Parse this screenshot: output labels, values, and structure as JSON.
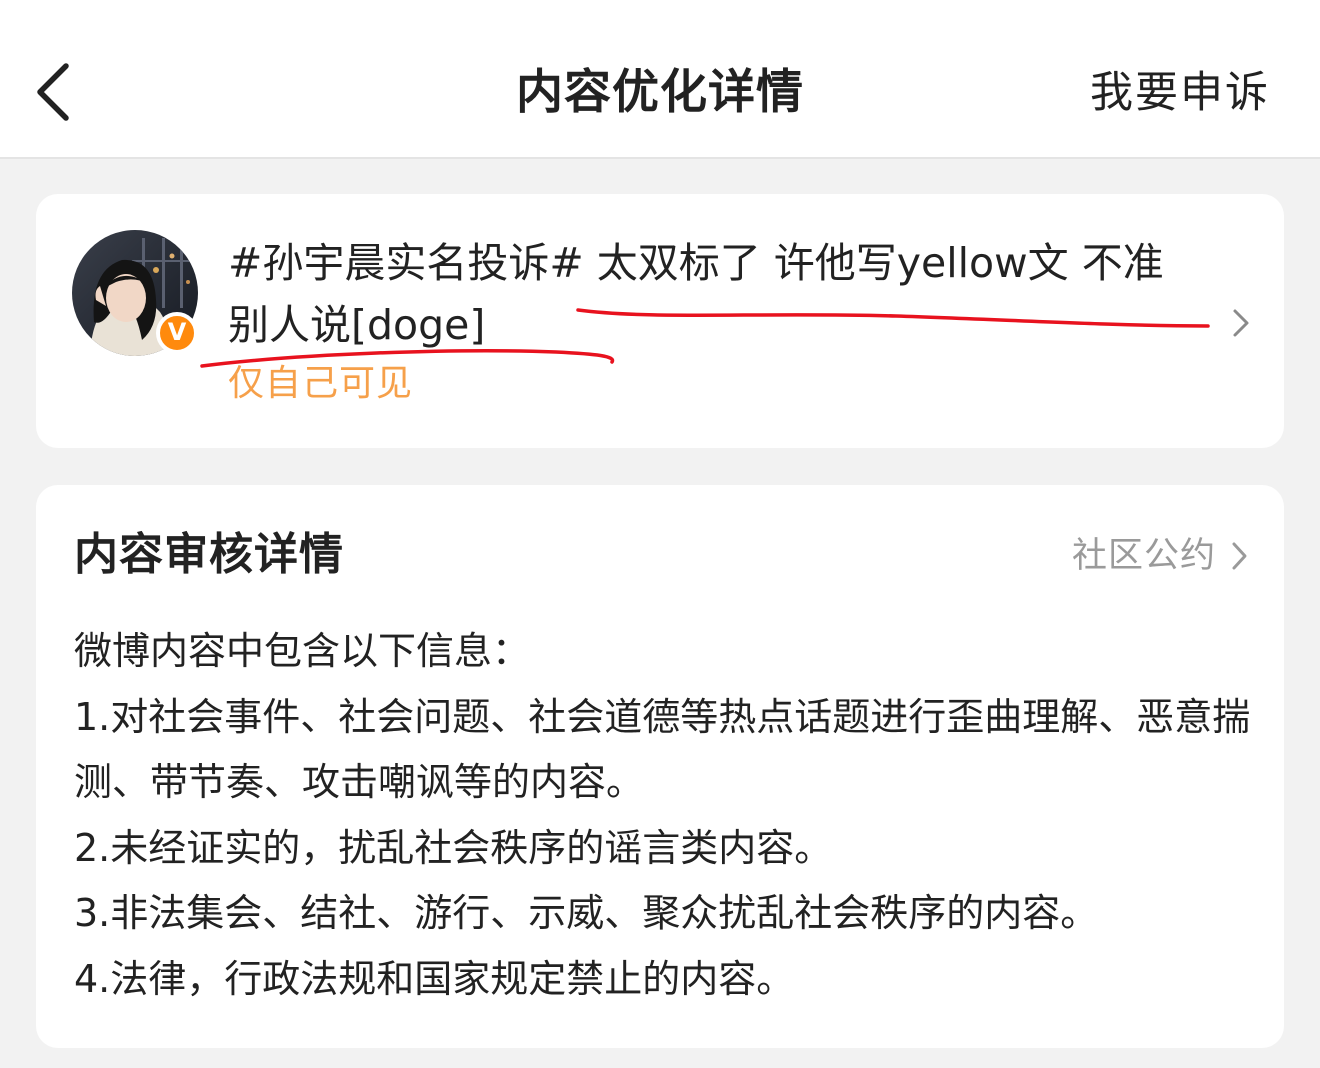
{
  "header": {
    "title": "内容优化详情",
    "appeal_label": "我要申诉"
  },
  "post": {
    "text": "#孙宇晨实名投诉# 太双标了 许他写yellow文 不准别人说[doge]",
    "visibility": "仅自己可见",
    "avatar_badge": "V"
  },
  "review": {
    "title": "内容审核详情",
    "community_link": "社区公约",
    "intro": "微博内容中包含以下信息：",
    "items": [
      "1.对社会事件、社会问题、社会道德等热点话题进行歪曲理解、恶意揣测、带节奏、攻击嘲讽等的内容。",
      "2.未经证实的，扰乱社会秩序的谣言类内容。",
      "3.非法集会、结社、游行、示威、聚众扰乱社会秩序的内容。",
      "4.法律，行政法规和国家规定禁止的内容。"
    ]
  },
  "colors": {
    "background": "#f2f2f2",
    "card": "#ffffff",
    "visibility_text": "#f6a04a",
    "badge": "#ff8a0d",
    "annotation_line": "#e8121e",
    "secondary_text": "#9a9a9a"
  }
}
